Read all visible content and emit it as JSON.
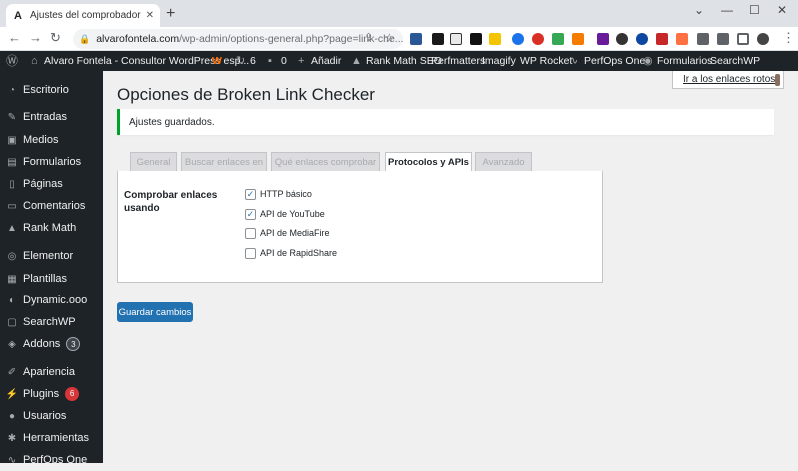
{
  "browser": {
    "tab_title": "Ajustes del comprobador de enlaces",
    "url_host": "alvarofontela.com",
    "url_path": "/wp-admin/options-general.php?page=link-che..."
  },
  "adminbar": {
    "site_name": "Alvaro Fontela - Consultor WordPress esp...",
    "updates_count": "6",
    "comments_count": "0",
    "add_new": "Añadir",
    "items": [
      "Rank Math SEO",
      "Perfmatters",
      "Imagify",
      "WP Rocket",
      "PerfOps One",
      "Formularios",
      "SearchWP"
    ]
  },
  "sidebar": {
    "items": [
      {
        "label": "Escritorio",
        "icon": "dashboard-icon"
      },
      {
        "label": "Entradas",
        "icon": "pin-icon"
      },
      {
        "label": "Medios",
        "icon": "media-icon"
      },
      {
        "label": "Formularios",
        "icon": "forms-icon"
      },
      {
        "label": "Páginas",
        "icon": "pages-icon"
      },
      {
        "label": "Comentarios",
        "icon": "comments-icon"
      },
      {
        "label": "Rank Math",
        "icon": "rank-math-icon"
      },
      {
        "label": "Elementor",
        "icon": "elementor-icon"
      },
      {
        "label": "Plantillas",
        "icon": "templates-icon"
      },
      {
        "label": "Dynamic.ooo",
        "icon": "dynamic-icon"
      },
      {
        "label": "SearchWP",
        "icon": "searchwp-icon"
      },
      {
        "label": "Addons",
        "icon": "addons-icon",
        "badge": "3"
      },
      {
        "label": "Apariencia",
        "icon": "appearance-icon"
      },
      {
        "label": "Plugins",
        "icon": "plugins-icon",
        "badge": "6"
      },
      {
        "label": "Usuarios",
        "icon": "users-icon"
      },
      {
        "label": "Herramientas",
        "icon": "tools-icon"
      },
      {
        "label": "PerfOps One",
        "icon": "perfops-icon"
      }
    ]
  },
  "main": {
    "page_title": "Opciones de Broken Link Checker",
    "top_link": "Ir a los enlaces rotos",
    "notice": "Ajustes guardados.",
    "tabs": [
      "General",
      "Buscar enlaces en",
      "Qué enlaces comprobar",
      "Protocolos y APIs",
      "Avanzado"
    ],
    "active_tab": "Protocolos y APIs",
    "field_label": "Comprobar enlaces usando",
    "options": [
      {
        "label": "HTTP básico",
        "checked": true
      },
      {
        "label": "API de YouTube",
        "checked": true
      },
      {
        "label": "API de MediaFire",
        "checked": false
      },
      {
        "label": "API de RapidShare",
        "checked": false
      }
    ],
    "save_label": "Guardar cambios"
  },
  "colors": {
    "admin_bg": "#1d2327",
    "primary": "#2271b1",
    "success": "#00a32a",
    "badge": "#d63638"
  }
}
